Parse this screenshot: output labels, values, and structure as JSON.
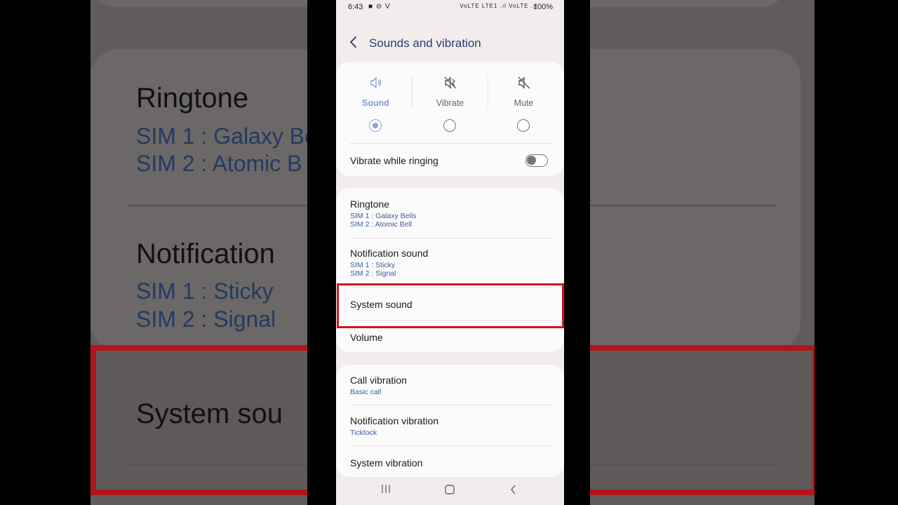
{
  "status_bar": {
    "time": "6:43",
    "left_icons": "■ ⊘ V",
    "signal_icons": "VoLTE LTE1 .ıl VoLTE .ıl",
    "battery": "100%"
  },
  "header": {
    "title": "Sounds and vibration"
  },
  "sound_modes": [
    {
      "label": "Sound",
      "icon": "speaker-icon",
      "selected": true
    },
    {
      "label": "Vibrate",
      "icon": "vibrate-icon",
      "selected": false
    },
    {
      "label": "Mute",
      "icon": "mute-icon",
      "selected": false
    }
  ],
  "vibrate_while_ringing": {
    "label": "Vibrate while ringing",
    "enabled": false
  },
  "sound_settings": {
    "ringtone": {
      "label": "Ringtone",
      "sim1": "SIM 1 : Galaxy Bells",
      "sim2": "SIM 2 : Atomic Bell"
    },
    "notification_sound": {
      "label": "Notification sound",
      "sim1": "SIM 1 : Sticky",
      "sim2": "SIM 2 : Signal"
    },
    "system_sound": {
      "label": "System sound"
    },
    "volume": {
      "label": "Volume"
    }
  },
  "vibration_settings": {
    "call_vibration": {
      "label": "Call vibration",
      "value": "Basic call"
    },
    "notification_vibration": {
      "label": "Notification vibration",
      "value": "Ticktock"
    },
    "system_vibration": {
      "label": "System vibration"
    }
  },
  "background_zoom": {
    "ringtone": "Ringtone",
    "ringtone_sim1": "SIM 1 : Galaxy Be",
    "ringtone_sim2": "SIM 2 : Atomic B",
    "notification": "Notification",
    "notification_sim1": "SIM 1 : Sticky",
    "notification_sim2": "SIM 2 : Signal",
    "system": "System sou"
  },
  "colors": {
    "accent": "#7f9cd2",
    "highlight": "#d0151e",
    "title": "#2a3a70"
  }
}
